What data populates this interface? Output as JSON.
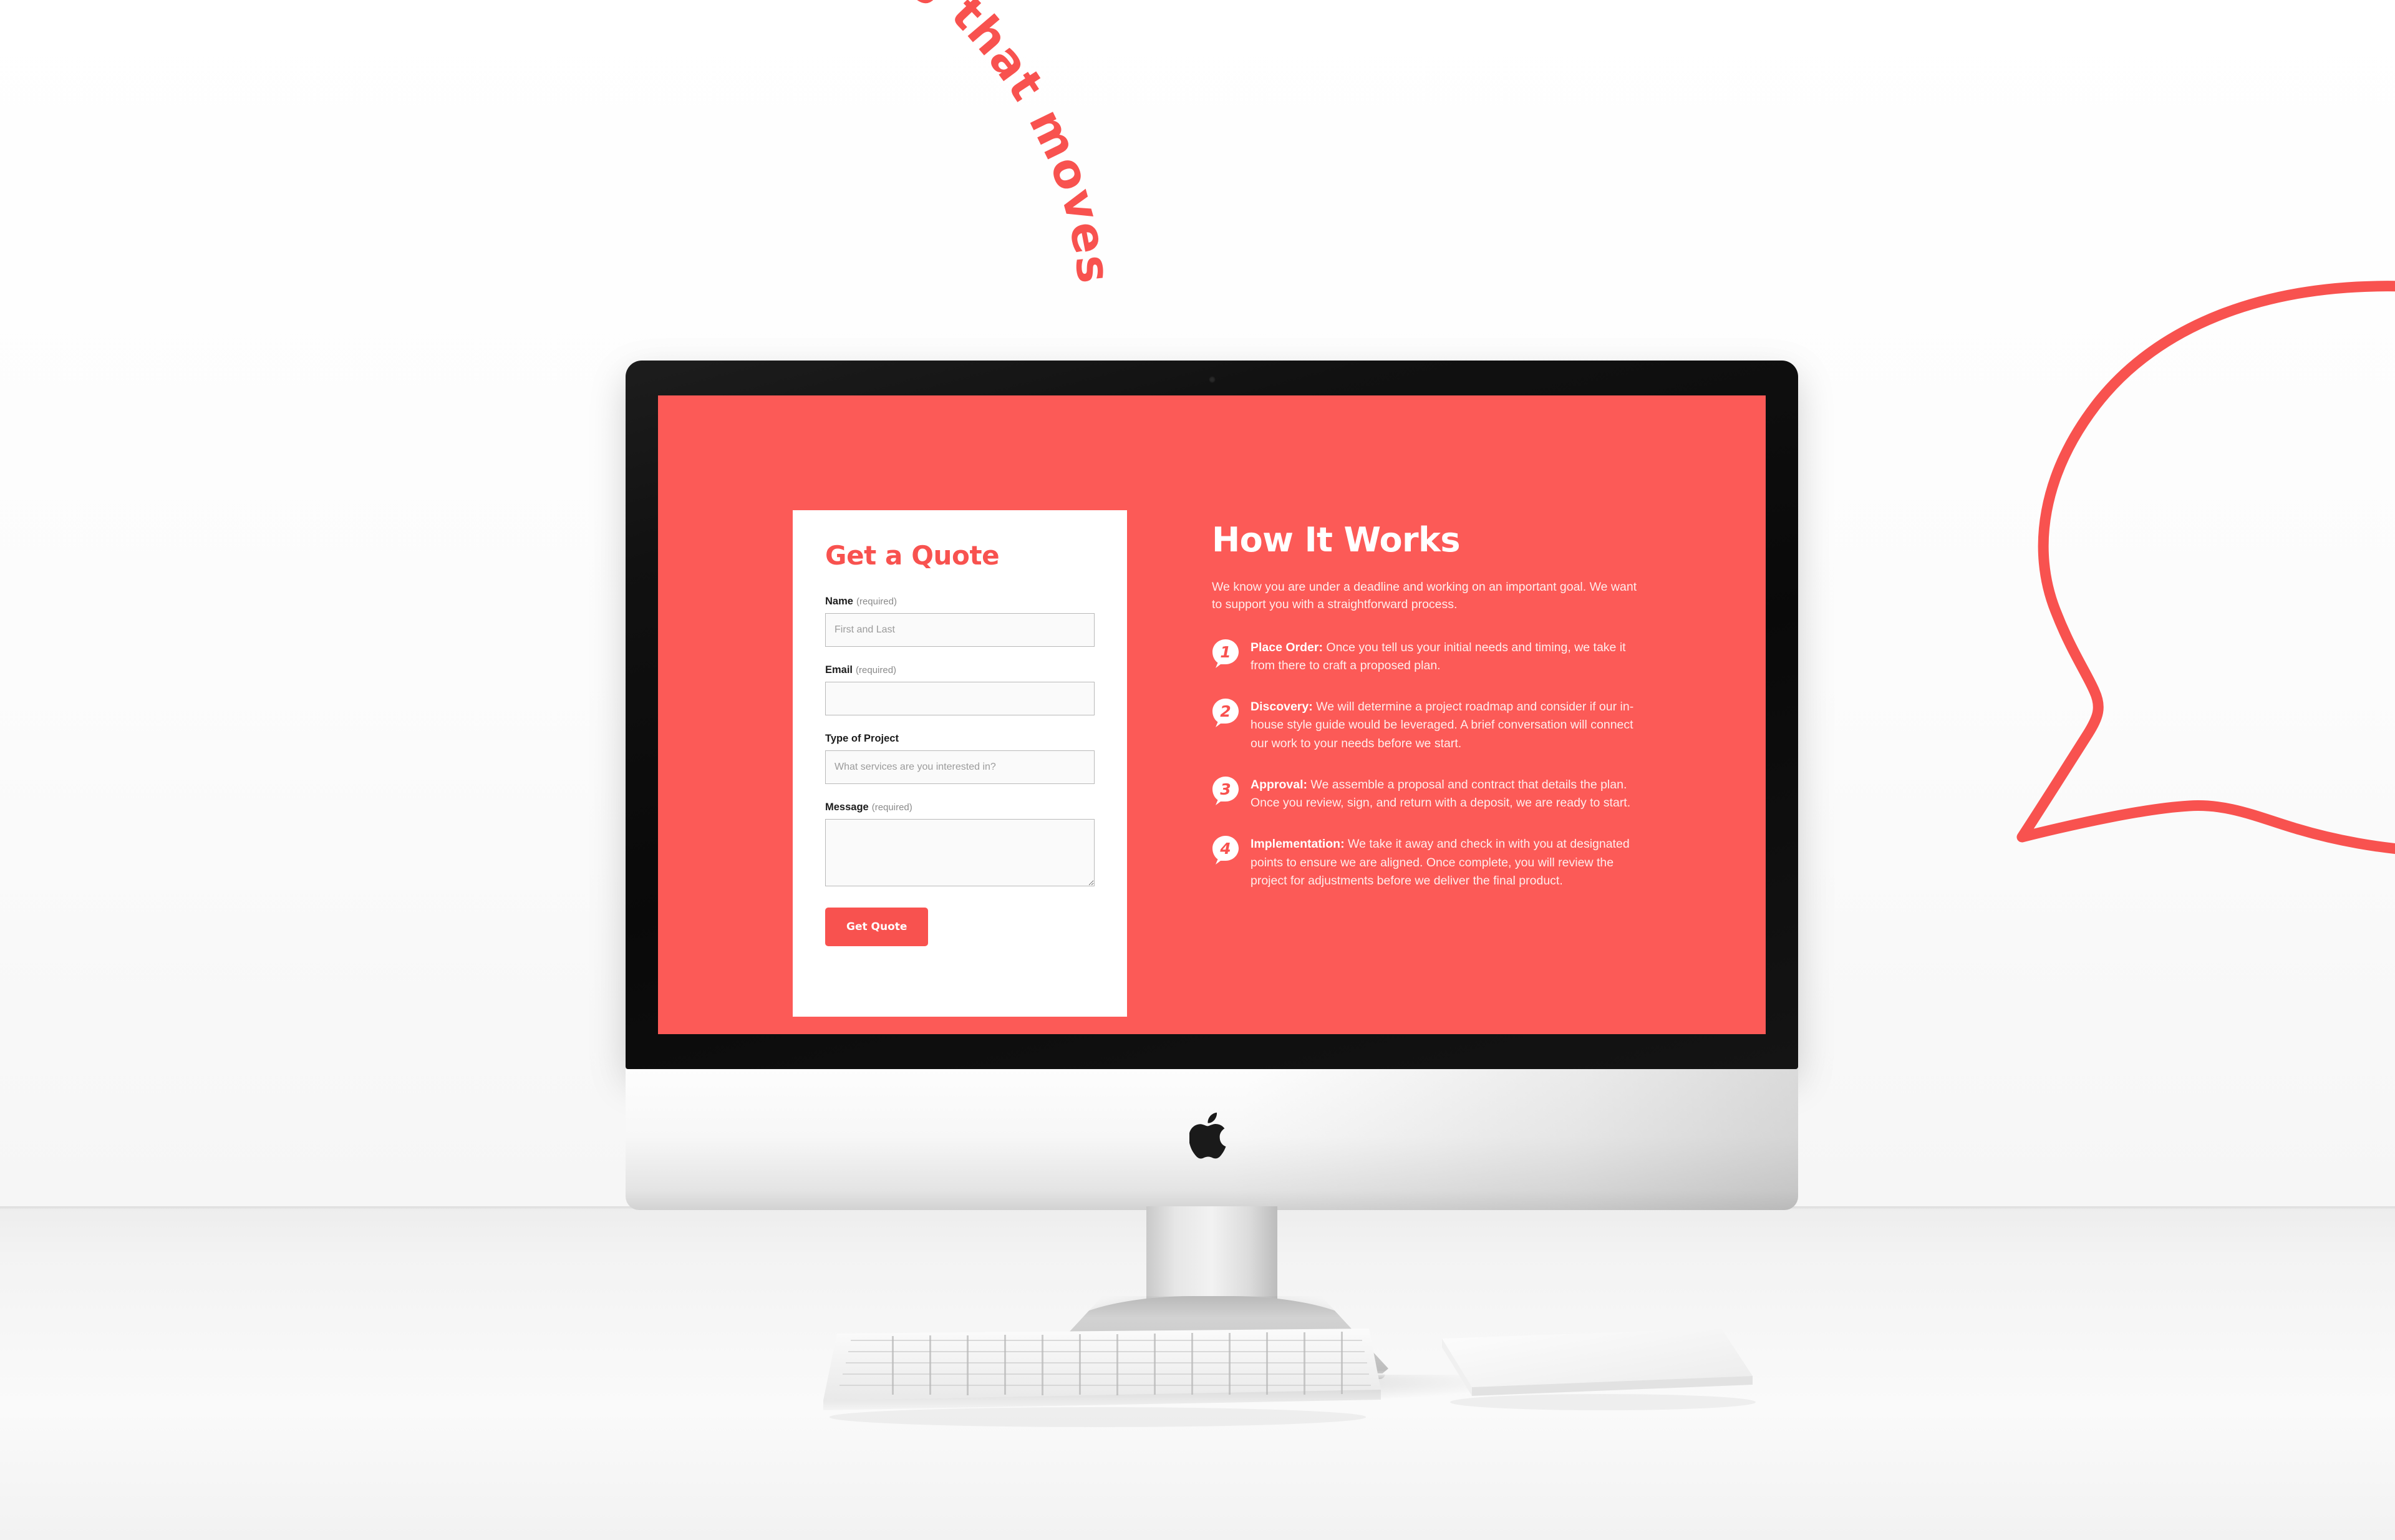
{
  "decor": {
    "curved_text": "writing that moves",
    "curved_text_separator": "•",
    "accent_color": "#f8524f",
    "bubble_shape": "speech-bubble-outline"
  },
  "device": {
    "brand_logo": "apple-logo",
    "peripherals": [
      "magic-keyboard",
      "magic-trackpad"
    ]
  },
  "screen": {
    "background_color": "#fc5a57",
    "form": {
      "title": "Get a Quote",
      "fields": [
        {
          "label": "Name",
          "required_note": "(required)",
          "placeholder": "First and Last",
          "value": "",
          "type": "text"
        },
        {
          "label": "Email",
          "required_note": "(required)",
          "placeholder": "",
          "value": "",
          "type": "text"
        },
        {
          "label": "Type of Project",
          "required_note": "",
          "placeholder": "What services are you interested in?",
          "value": "",
          "type": "text"
        },
        {
          "label": "Message",
          "required_note": "(required)",
          "placeholder": "",
          "value": "",
          "type": "textarea"
        }
      ],
      "submit_label": "Get Quote"
    },
    "how_it_works": {
      "title": "How It Works",
      "intro": "We know you are under a deadline and working on an important goal. We want to support you with a straightforward process.",
      "steps": [
        {
          "number": "1",
          "heading": "Place Order:",
          "body": " Once you tell us your initial needs and timing, we take it from there to craft a proposed plan."
        },
        {
          "number": "2",
          "heading": "Discovery:",
          "body": " We will determine a project roadmap and consider if our in-house style guide would be leveraged. A brief conversation will connect our work to your needs before we start."
        },
        {
          "number": "3",
          "heading": "Approval:",
          "body": " We assemble a proposal and contract that details the plan. Once you review, sign, and return with a deposit, we are ready to start."
        },
        {
          "number": "4",
          "heading": "Implementation:",
          "body": " We take it away and check in with you at designated points to ensure we are aligned. Once complete, you will review the project for adjustments before we deliver the final product."
        }
      ]
    }
  }
}
